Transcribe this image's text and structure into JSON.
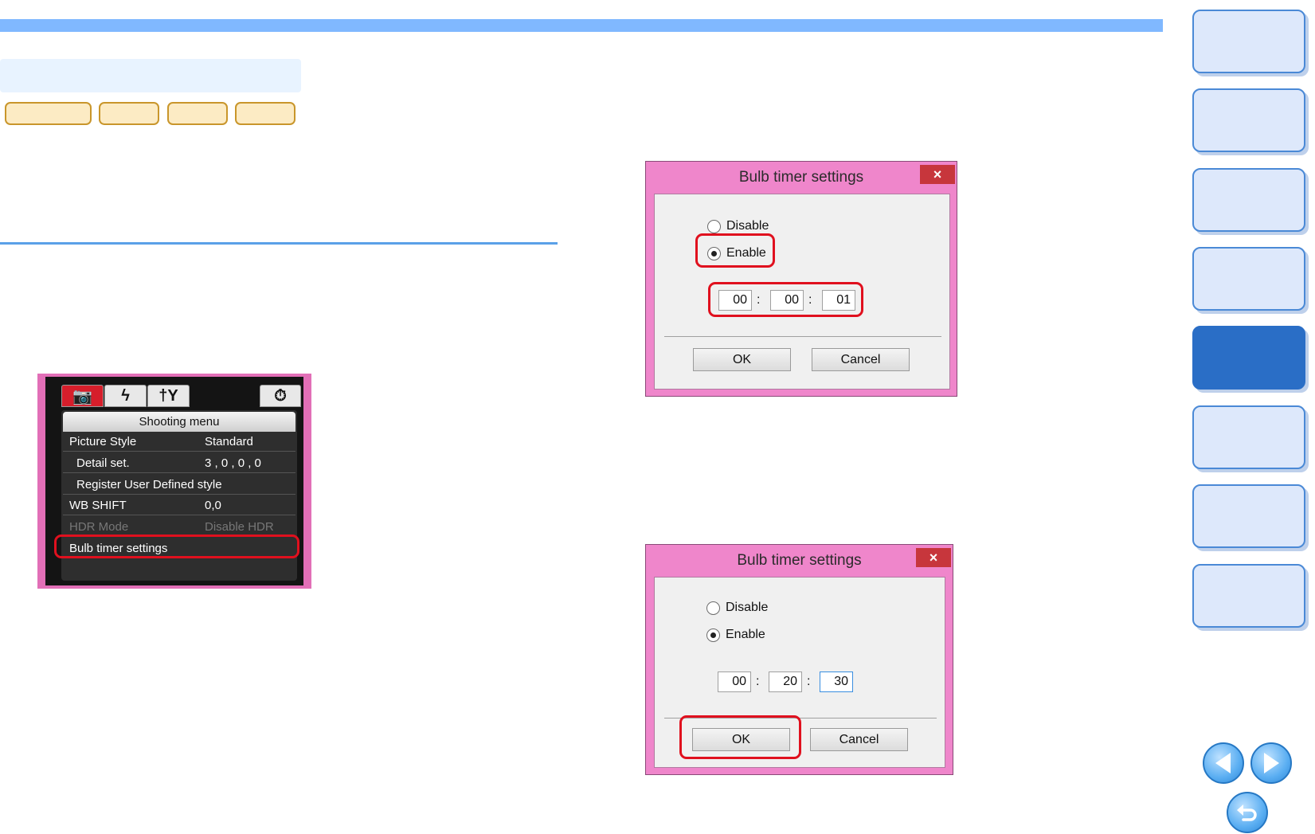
{
  "camera_menu": {
    "tabs": [
      {
        "icon": "camera-icon",
        "glyph": "📷"
      },
      {
        "icon": "flash-icon",
        "glyph": "ϟ"
      },
      {
        "icon": "tools-icon",
        "glyph": "†Y"
      },
      {
        "icon": "timer-icon",
        "glyph": "⏱"
      }
    ],
    "header": "Shooting menu",
    "rows": [
      {
        "label": "Picture Style",
        "value": "Standard"
      },
      {
        "label": "Detail set.",
        "value": "3 , 0 , 0 , 0"
      },
      {
        "label": "Register User Defined style",
        "value": ""
      },
      {
        "label": "WB SHIFT",
        "value": "0,0"
      },
      {
        "label": "HDR Mode",
        "value": "Disable HDR"
      },
      {
        "label": "Bulb timer settings",
        "value": ""
      }
    ]
  },
  "dialog1": {
    "title": "Bulb timer settings",
    "close_glyph": "×",
    "disable_label": "Disable",
    "enable_label": "Enable",
    "selected": "enable",
    "hours": "00",
    "minutes": "00",
    "seconds": "01",
    "separator": ":",
    "ok_label": "OK",
    "cancel_label": "Cancel"
  },
  "dialog2": {
    "title": "Bulb timer settings",
    "close_glyph": "×",
    "disable_label": "Disable",
    "enable_label": "Enable",
    "selected": "enable",
    "hours": "00",
    "minutes": "20",
    "seconds": "30",
    "separator": ":",
    "ok_label": "OK",
    "cancel_label": "Cancel"
  },
  "colors": {
    "accent_blue": "#80b8ff",
    "highlight_red": "#e0101e",
    "dialog_pink": "#ef86cb"
  }
}
